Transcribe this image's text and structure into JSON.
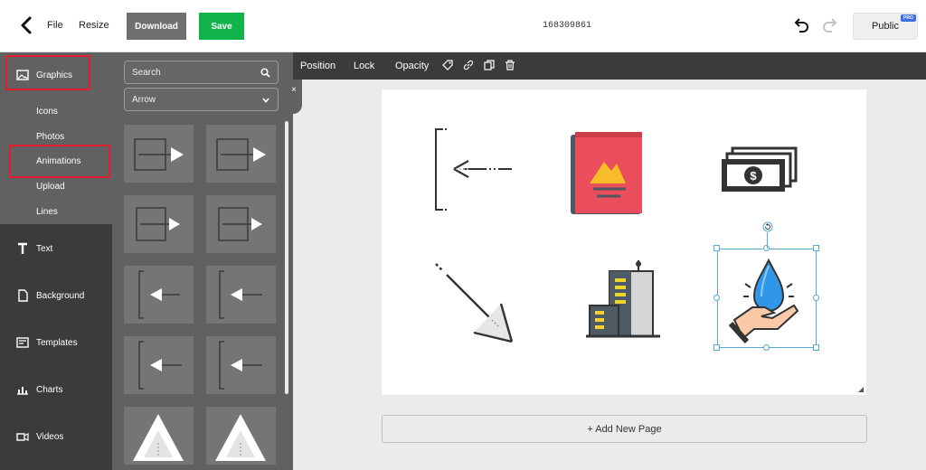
{
  "topbar": {
    "file_label": "File",
    "resize_label": "Resize",
    "download_label": "Download",
    "save_label": "Save",
    "document_id": "168309861",
    "public_label": "Public",
    "pro_badge": "PRO"
  },
  "leftnav": {
    "graphics_label": "Graphics",
    "sub_items": [
      "Icons",
      "Photos",
      "Animations",
      "Upload",
      "Lines"
    ],
    "items": [
      "Text",
      "Background",
      "Templates",
      "Charts",
      "Videos"
    ]
  },
  "panel": {
    "search_placeholder": "Search",
    "category_selected": "Arrow"
  },
  "toolbar": {
    "position_label": "Position",
    "lock_label": "Lock",
    "opacity_label": "Opacity"
  },
  "canvas": {
    "add_page_label": "+ Add New Page"
  },
  "colors": {
    "save_green": "#11b44b",
    "highlight_red": "#e0202e",
    "selection_blue": "#58a9d6",
    "nav_dark": "#3b3b3b",
    "panel_gray": "#616161"
  }
}
